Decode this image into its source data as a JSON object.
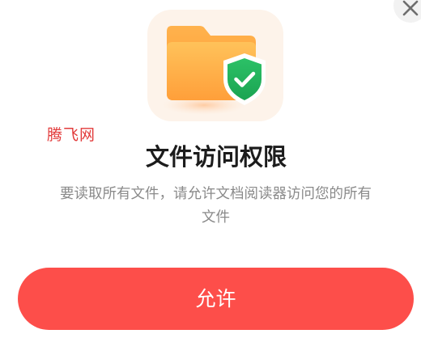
{
  "dialog": {
    "watermark": "腾飞网",
    "title": "文件访问权限",
    "description": "要读取所有文件，请允许文档阅读器访问您的所有文件",
    "allow_button_label": "允许"
  },
  "icons": {
    "close": "close-icon",
    "folder": "folder-icon",
    "shield_check": "shield-check-icon"
  },
  "colors": {
    "accent": "#fd4e4a",
    "folder": "#ffa63e",
    "shield": "#22b35b",
    "title": "#1c1c1c",
    "description": "#8a8a8a",
    "watermark": "#e23a3a"
  }
}
